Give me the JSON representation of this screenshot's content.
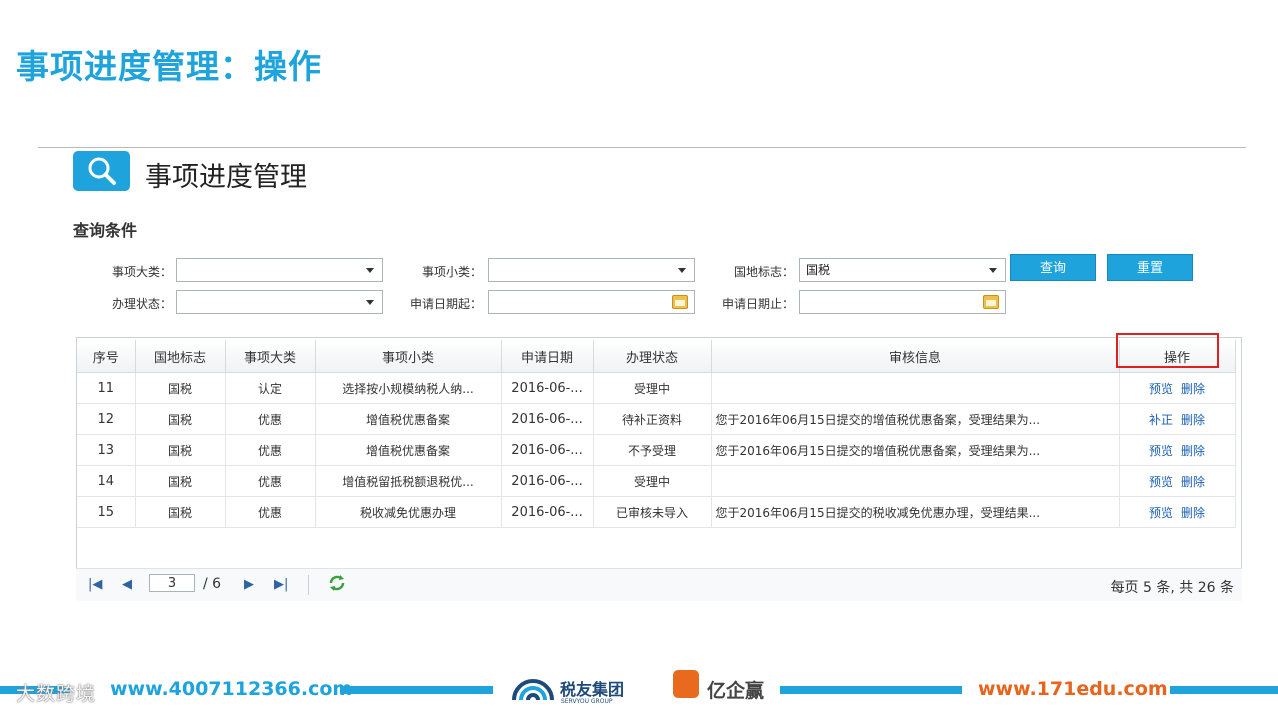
{
  "slide_title": "事项进度管理：操作",
  "app": {
    "title": "事项进度管理",
    "section_label": "查询条件"
  },
  "filters": {
    "category_label": "事项大类：",
    "category_value": "",
    "subcategory_label": "事项小类：",
    "subcategory_value": "",
    "tax_label": "国地标志：",
    "tax_value": "国税",
    "status_label": "办理状态：",
    "status_value": "",
    "date_start_label": "申请日期起：",
    "date_start_value": "",
    "date_end_label": "申请日期止：",
    "date_end_value": ""
  },
  "buttons": {
    "query": "查询",
    "reset": "重置"
  },
  "table": {
    "headers": [
      "序号",
      "国地标志",
      "事项大类",
      "事项小类",
      "申请日期",
      "办理状态",
      "审核信息",
      "操作"
    ],
    "rows": [
      {
        "no": "11",
        "tax": "国税",
        "cat": "认定",
        "sub": "选择按小规模纳税人纳...",
        "date": "2016-06-...",
        "status": "受理中",
        "info": "",
        "op1": "预览",
        "op2": "删除"
      },
      {
        "no": "12",
        "tax": "国税",
        "cat": "优惠",
        "sub": "增值税优惠备案",
        "date": "2016-06-...",
        "status": "待补正资料",
        "info": "您于2016年06月15日提交的增值税优惠备案，受理结果为...",
        "op1": "补正",
        "op2": "删除"
      },
      {
        "no": "13",
        "tax": "国税",
        "cat": "优惠",
        "sub": "增值税优惠备案",
        "date": "2016-06-...",
        "status": "不予受理",
        "info": "您于2016年06月15日提交的增值税优惠备案，受理结果为...",
        "op1": "预览",
        "op2": "删除"
      },
      {
        "no": "14",
        "tax": "国税",
        "cat": "优惠",
        "sub": "增值税留抵税额退税优...",
        "date": "2016-06-...",
        "status": "受理中",
        "info": "",
        "op1": "预览",
        "op2": "删除"
      },
      {
        "no": "15",
        "tax": "国税",
        "cat": "优惠",
        "sub": "税收减免优惠办理",
        "date": "2016-06-...",
        "status": "已审核未导入",
        "info": "您于2016年06月15日提交的税收减免优惠办理，受理结果...",
        "op1": "预览",
        "op2": "删除"
      }
    ]
  },
  "pager": {
    "current_page": "3",
    "total_pages": "/ 6",
    "summary": "每页 5 条, 共 26 条"
  },
  "footer": {
    "url_left": "www.4007112366.com",
    "url_right": "www.171edu.com",
    "logo1": "税友集团",
    "logo1_sub": "SERVYOU GROUP",
    "logo2": "亿企赢",
    "watermark": "大数跨境"
  },
  "colors": {
    "accent": "#1fa3dd",
    "footer_url": "#e8641c",
    "highlight": "#e02020"
  }
}
